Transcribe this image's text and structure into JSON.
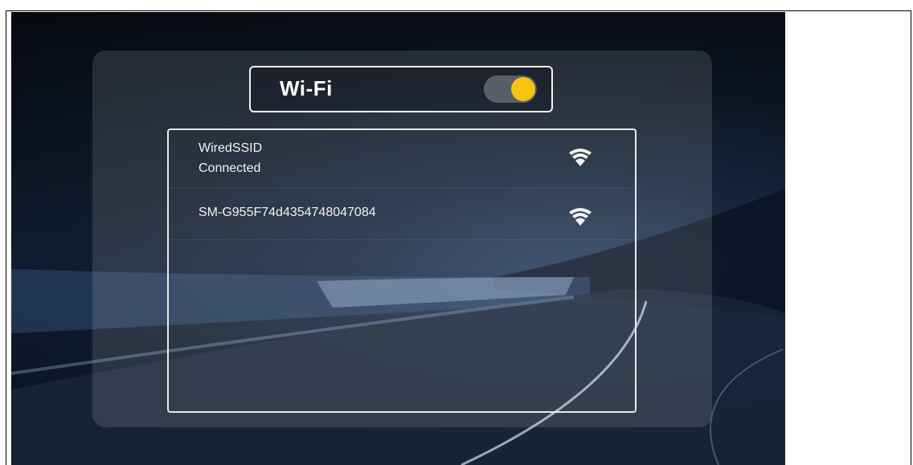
{
  "wifi": {
    "title": "Wi-Fi",
    "enabled": true,
    "toggle_color": "#f7c313"
  },
  "networks": [
    {
      "ssid": "WiredSSID",
      "status": "Connected",
      "icon": "wifi-signal-icon"
    },
    {
      "ssid": "SM-G955F74d4354748047084",
      "status": "",
      "icon": "wifi-signal-icon"
    }
  ]
}
